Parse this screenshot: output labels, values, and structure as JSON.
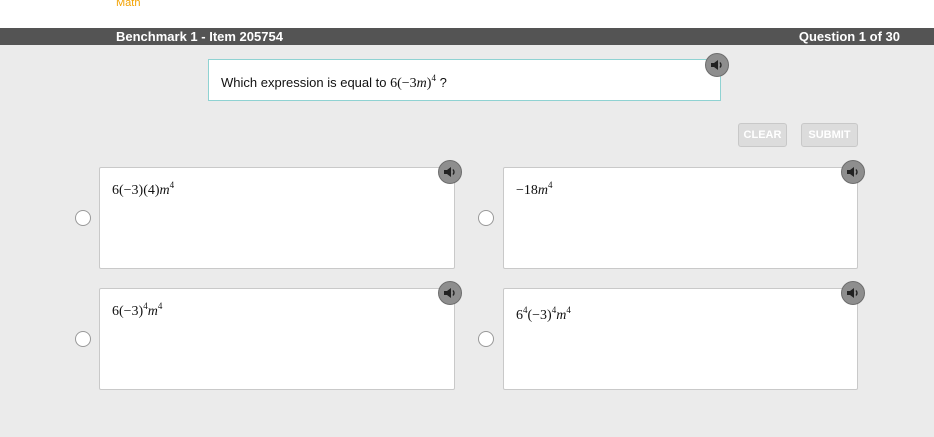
{
  "header": {
    "subject": "Math",
    "benchmark_title": "Benchmark 1 - Item 205754",
    "question_counter": "Question 1 of 30"
  },
  "question": {
    "prefix": "Which expression is equal to ",
    "expr_base": "6(−3",
    "expr_var": "m",
    "expr_close": ")",
    "expr_exp": "4",
    "suffix": " ?"
  },
  "toolbar": {
    "clear_label": "CLEAR",
    "submit_label": "SUBMIT"
  },
  "choices": [
    {
      "parts": {
        "a": "6(−3)(4)",
        "var": "m",
        "exp": "4"
      }
    },
    {
      "parts": {
        "a": "−18",
        "var": "m",
        "exp": "4"
      }
    },
    {
      "parts": {
        "a": "6(−3)",
        "aexp": "4",
        "var": "m",
        "exp": "4"
      }
    },
    {
      "parts": {
        "a": "6",
        "aexp": "4",
        "b": "(−3)",
        "bexp": "4",
        "var": "m",
        "exp": "4"
      }
    }
  ],
  "icons": {
    "speaker": "speaker-icon"
  },
  "colors": {
    "title_bar": "#545454",
    "subject": "#f2a100",
    "prompt_border": "#8fd2d2",
    "background": "#ebebeb"
  }
}
